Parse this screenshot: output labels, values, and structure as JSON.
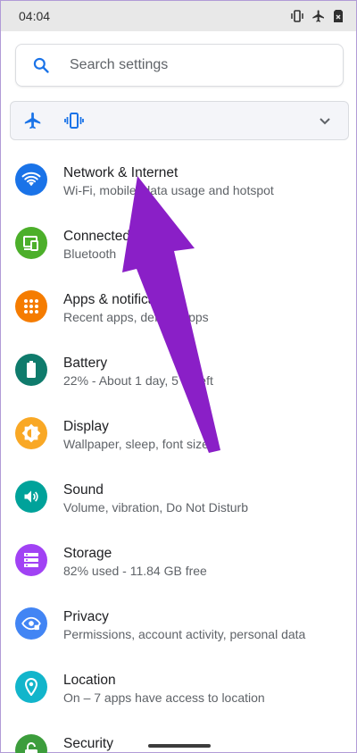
{
  "status": {
    "time": "04:04",
    "icons": [
      "vibrate-icon",
      "airplane-icon",
      "no-sim-icon"
    ]
  },
  "search": {
    "placeholder": "Search settings",
    "icon": "search-icon"
  },
  "quick": {
    "icons": [
      "airplane-icon",
      "vibrate-icon"
    ],
    "expand_icon": "chevron-down-icon"
  },
  "items": [
    {
      "title": "Network & Internet",
      "subtitle": "Wi-Fi, mobile, data usage and hotspot",
      "color": "#1a73e8",
      "icon": "wifi-icon"
    },
    {
      "title": "Connected devices",
      "subtitle": "Bluetooth",
      "color": "#4caf2a",
      "icon": "devices-icon"
    },
    {
      "title": "Apps & notifications",
      "subtitle": "Recent apps, default apps",
      "color": "#f57c00",
      "icon": "apps-grid-icon"
    },
    {
      "title": "Battery",
      "subtitle": "22% - About 1 day, 5 hr left",
      "color": "#0f7b6c",
      "icon": "battery-icon"
    },
    {
      "title": "Display",
      "subtitle": "Wallpaper, sleep, font size",
      "color": "#f9a825",
      "icon": "brightness-icon"
    },
    {
      "title": "Sound",
      "subtitle": "Volume, vibration, Do Not Disturb",
      "color": "#00a29a",
      "icon": "volume-icon"
    },
    {
      "title": "Storage",
      "subtitle": "82% used - 11.84 GB free",
      "color": "#a142f4",
      "icon": "storage-icon"
    },
    {
      "title": "Privacy",
      "subtitle": "Permissions, account activity, personal data",
      "color": "#4285f4",
      "icon": "privacy-eye-icon"
    },
    {
      "title": "Location",
      "subtitle": "On – 7 apps have access to location",
      "color": "#12b5cb",
      "icon": "location-pin-icon"
    },
    {
      "title": "Security",
      "subtitle": "",
      "color": "#3c9d3c",
      "icon": "lock-icon"
    }
  ],
  "annotation": {
    "color": "#8a1fc7",
    "icon": "pointer-arrow"
  }
}
